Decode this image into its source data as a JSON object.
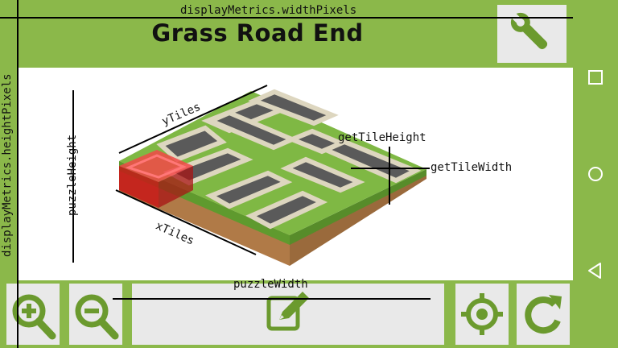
{
  "title": "Grass Road End",
  "annotations": {
    "display_width": "displayMetrics.widthPixels",
    "display_height": "displayMetrics.heightPixels",
    "puzzle_height": "puzzleHeight",
    "puzzle_width": "puzzleWidth",
    "y_tiles": "yTiles",
    "x_tiles": "xTiles",
    "tile_height": "getTileHeight",
    "tile_width": "getTileWidth"
  },
  "toolbar": {
    "zoom_in": "zoom-in-icon",
    "zoom_out": "zoom-out-icon",
    "edit": "edit-icon",
    "center": "crosshair-icon",
    "reset": "refresh-icon"
  },
  "colors": {
    "background": "#8bb84a",
    "button": "#e9e9e9",
    "icon": "#6b9a2e",
    "grass": "#7fb844",
    "road": "#555555",
    "selection": "#e02020"
  }
}
